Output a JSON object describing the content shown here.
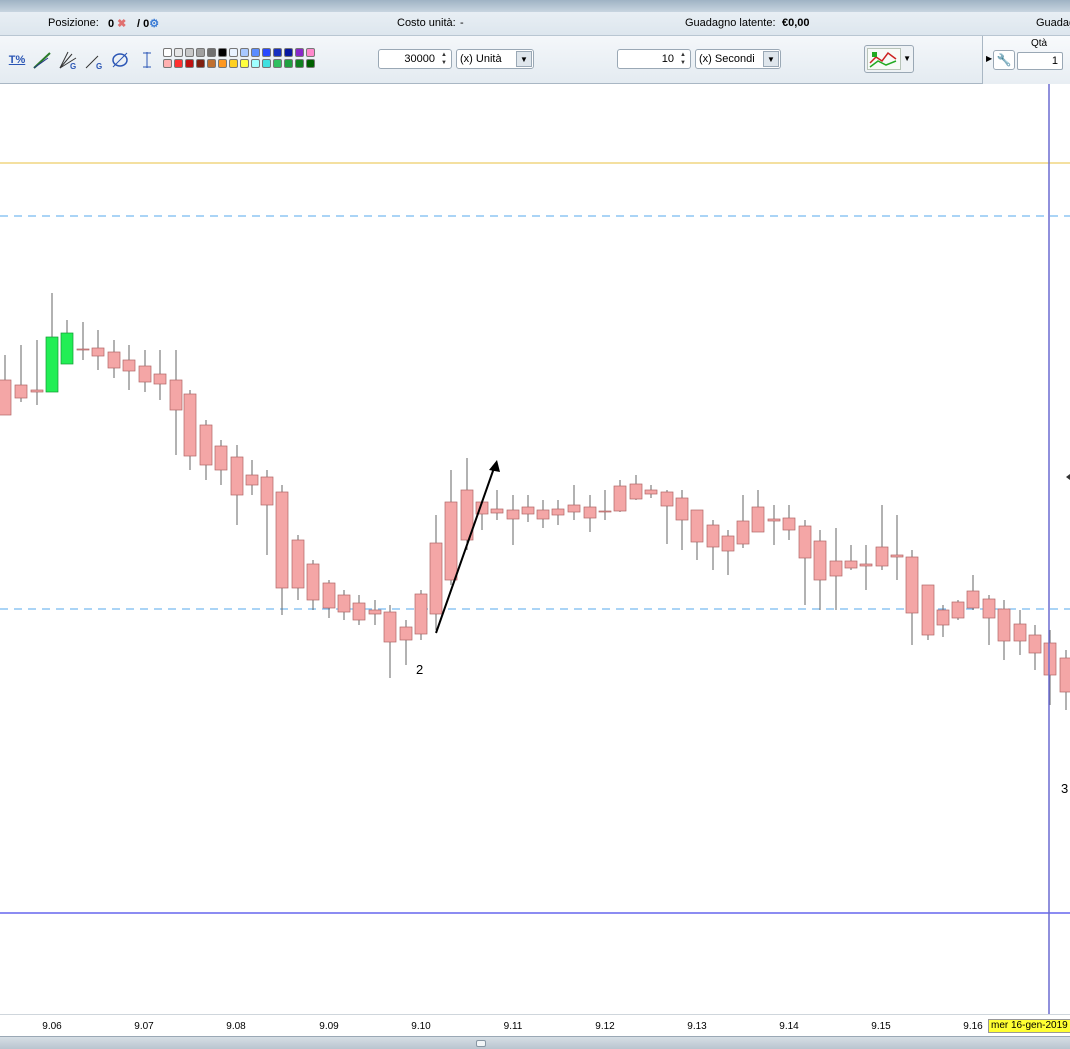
{
  "statusbar": {
    "position_label": "Posizione:",
    "position_value": "0",
    "position_orders": "/ 0",
    "unit_cost_label": "Costo unità:",
    "unit_cost_value": "-",
    "latent_gain_label": "Guadagno latente:",
    "latent_gain_value": "€0,00",
    "gain_truncated_label": "Guadag"
  },
  "toolbar": {
    "percent_tool_label": "T%",
    "quantity_value": "30000",
    "quantity_unit": "(x) Unità",
    "period_value": "10",
    "period_unit": "(x) Secondi",
    "qty_label": "Qtà",
    "qty_value": "1",
    "swatch_colors": [
      "#ffffff",
      "#e6e6e6",
      "#c8c8c8",
      "#a0a0a0",
      "#707070",
      "#000000",
      "#e8f2ff",
      "#a8c8ff",
      "#5a8cff",
      "#2848ff",
      "#1830c0",
      "#0818a0",
      "#8828c8",
      "#ff88cc",
      "#ffb0b0",
      "#ff3030",
      "#c01010",
      "#802010",
      "#c07030",
      "#ff9820",
      "#ffd020",
      "#ffff40",
      "#a0ffff",
      "#40e0e0",
      "#30c060",
      "#20a040",
      "#108020",
      "#006000"
    ]
  },
  "chart": {
    "annotation_2": "2",
    "annotation_3": "3",
    "up_color": "#22ee55",
    "down_color": "#f4a6a6",
    "hline_orange_color": "#e8c040",
    "hline_dashed_color": "#55aaee",
    "hline_blue_color": "#6666ee",
    "cursor_line_color": "#6c6cd0"
  },
  "xaxis": {
    "ticks": [
      "9.06",
      "9.07",
      "9.08",
      "9.09",
      "9.10",
      "9.11",
      "9.12",
      "9.13",
      "9.14",
      "9.15",
      "9.16"
    ],
    "cursor_date": "mer 16-gen-2019"
  }
}
